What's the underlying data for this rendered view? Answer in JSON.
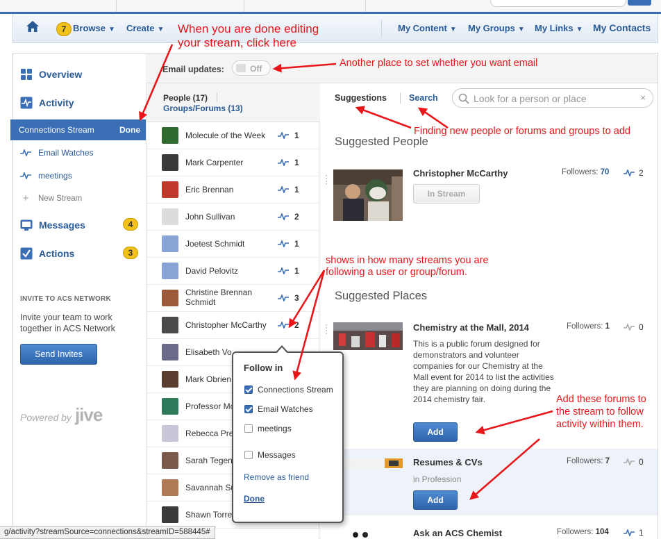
{
  "nav": {
    "home_badge": "7",
    "browse": "Browse",
    "create": "Create",
    "my_content": "My Content",
    "my_groups": "My Groups",
    "my_links": "My Links",
    "my_contacts": "My Contacts"
  },
  "sidebar": {
    "overview": "Overview",
    "activity": "Activity",
    "connections_stream": "Connections Stream",
    "done": "Done",
    "email_watches": "Email Watches",
    "meetings": "meetings",
    "new_stream": "New Stream",
    "messages": "Messages",
    "messages_badge": "4",
    "actions": "Actions",
    "actions_badge": "3",
    "invite_heading": "INVITE TO ACS NETWORK",
    "invite_text": "Invite your team to work together in ACS Network",
    "send_invites": "Send Invites",
    "powered_by": "Powered by",
    "jive": "jive"
  },
  "email_updates": {
    "label": "Email updates:",
    "state": "Off"
  },
  "people_panel": {
    "people_tab": "People (17)",
    "groups_tab": "Groups/Forums (13)",
    "rows": [
      {
        "name": "Molecule of the Week",
        "count": "1"
      },
      {
        "name": "Mark Carpenter",
        "count": "1"
      },
      {
        "name": "Eric Brennan",
        "count": "1"
      },
      {
        "name": "John Sullivan",
        "count": "2"
      },
      {
        "name": "Joetest Schmidt",
        "count": "1"
      },
      {
        "name": "David Pelovitz",
        "count": "1"
      },
      {
        "name": "Christine Brennan Schmidt",
        "count": "3"
      },
      {
        "name": "Christopher McCarthy",
        "count": "2"
      },
      {
        "name": "Elisabeth Vo",
        "count": ""
      },
      {
        "name": "Mark Obrien",
        "count": ""
      },
      {
        "name": "Professor Mo",
        "count": ""
      },
      {
        "name": "Rebecca Pres",
        "count": ""
      },
      {
        "name": "Sarah Tegen",
        "count": ""
      },
      {
        "name": "Savannah Su",
        "count": ""
      },
      {
        "name": "Shawn Torres",
        "count": ""
      }
    ]
  },
  "right_pane": {
    "tab_suggestions": "Suggestions",
    "tab_search": "Search",
    "search_placeholder": "Look for a person or place",
    "suggested_people_title": "Suggested People",
    "suggested_places_title": "Suggested Places",
    "people": [
      {
        "name": "Christopher McCarthy",
        "followers_label": "Followers:",
        "followers": "70",
        "streams": "2",
        "button": "In Stream"
      }
    ],
    "places": [
      {
        "name": "Chemistry at the Mall, 2014",
        "followers_label": "Followers:",
        "followers": "1",
        "streams": "0",
        "description": "This is a public forum designed for demonstrators and volunteer companies for our Chemistry at the Mall event for 2014 to list the activities they are planning on doing during the 2014 chemistry fair.",
        "button": "Add"
      },
      {
        "name": "Resumes & CVs",
        "followers_label": "Followers:",
        "followers": "7",
        "streams": "0",
        "subtitle": "in Profession",
        "button": "Add"
      },
      {
        "name": "Ask an ACS Chemist",
        "followers_label": "Followers:",
        "followers": "104",
        "streams": "1"
      }
    ]
  },
  "popup": {
    "title": "Follow in",
    "options": [
      {
        "label": "Connections Stream",
        "checked": true
      },
      {
        "label": "Email Watches",
        "checked": true
      },
      {
        "label": "meetings",
        "checked": false
      },
      {
        "label": "Messages",
        "checked": false
      }
    ],
    "remove": "Remove as friend",
    "done": "Done"
  },
  "status_url": "g/activity?streamSource=connections&streamID=588445#",
  "annotations": {
    "done_editing_1": "When you are done editing",
    "done_editing_2": "your stream, click here",
    "email": "Another place to set  whether you want email",
    "finding": "Finding new people or forums and groups to add",
    "streams_1": "shows in how many streams you are",
    "streams_2": "following a user or group/forum.",
    "add_forums_1": "Add these forums to",
    "add_forums_2": "the stream to follow",
    "add_forums_3": "activity within them."
  },
  "colors": {
    "accent": "#3b6fb5",
    "link": "#2a5a96",
    "badge": "#f2c21b",
    "annotation": "#e8161b"
  }
}
